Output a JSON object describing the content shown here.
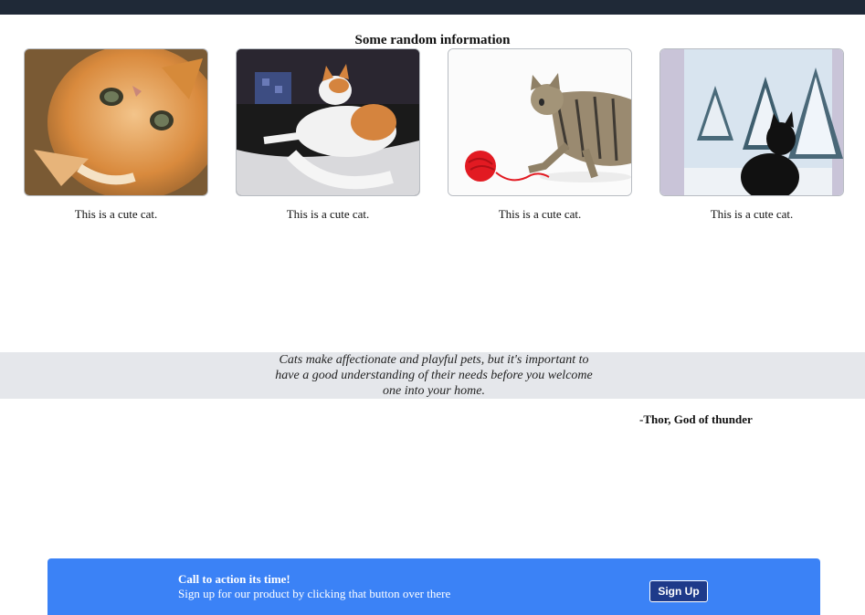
{
  "section": {
    "title": "Some random information"
  },
  "cards": [
    {
      "image_alt": "orange kitten lying on its back",
      "caption": "This is a cute cat."
    },
    {
      "image_alt": "orange and white cat lying on a bed",
      "caption": "This is a cute cat."
    },
    {
      "image_alt": "tabby kitten playing with red yarn",
      "caption": "This is a cute cat."
    },
    {
      "image_alt": "black cat looking out a snowy window",
      "caption": "This is a cute cat."
    }
  ],
  "quote": {
    "text": "Cats make affectionate and playful pets, but it's important to have a good understanding of their needs before you welcome one into your home.",
    "author": "-Thor, God of thunder"
  },
  "cta": {
    "title": "Call to action its time!",
    "subtitle": "Sign up for our product by clicking that button over there",
    "button_label": "Sign Up"
  },
  "colors": {
    "topbar": "#1f2937",
    "quote_band": "#e5e7eb",
    "cta_background": "#3b82f6",
    "cta_button": "#1e3a8a"
  }
}
